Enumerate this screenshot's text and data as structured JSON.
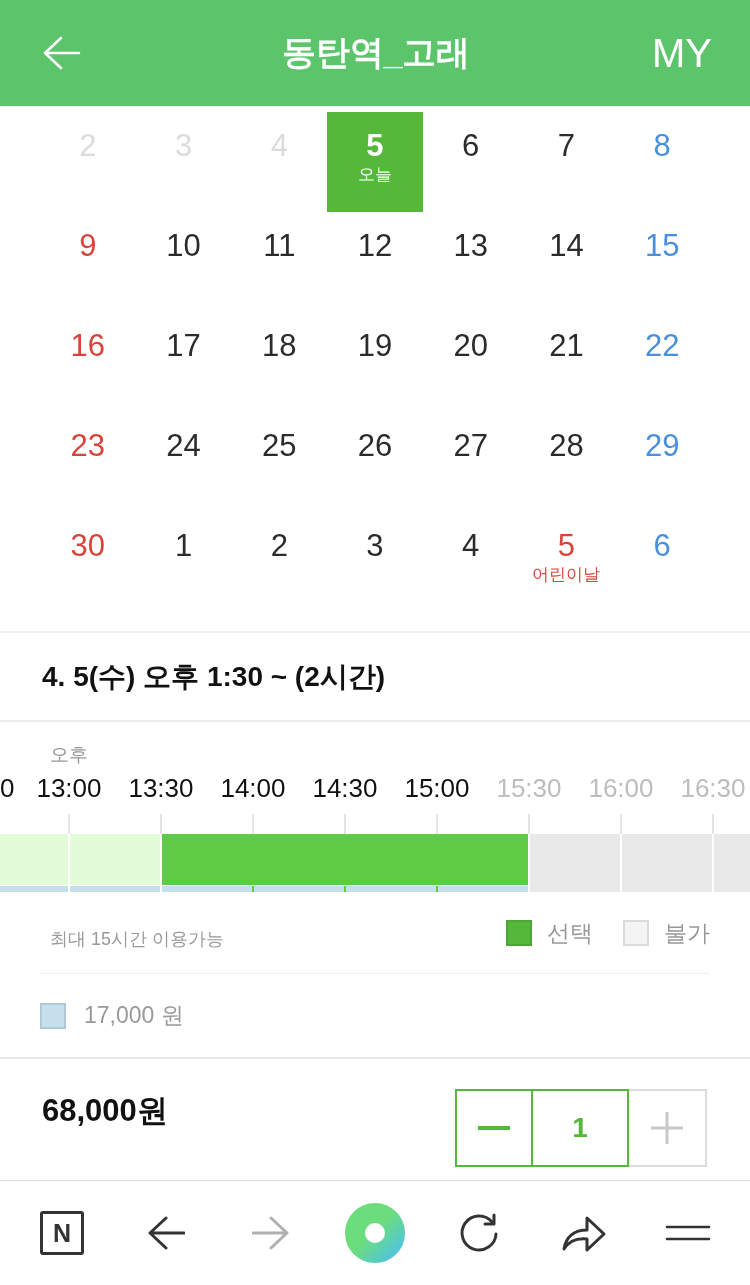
{
  "header": {
    "title": "동탄역_고래",
    "link": "MY"
  },
  "calendar": {
    "weeks": [
      [
        {
          "day": "2",
          "selected": false,
          "disabled": true,
          "holiday": false
        },
        {
          "day": "3",
          "selected": false,
          "disabled": true,
          "holiday": false
        },
        {
          "day": "4",
          "selected": false,
          "disabled": true,
          "holiday": false
        },
        {
          "day": "5",
          "note": "오늘",
          "selected": true,
          "disabled": false,
          "holiday": false
        },
        {
          "day": "6",
          "selected": false,
          "disabled": false,
          "holiday": false
        },
        {
          "day": "7",
          "selected": false,
          "disabled": false,
          "holiday": false
        },
        {
          "day": "8",
          "selected": false,
          "disabled": false,
          "holiday": false
        }
      ],
      [
        {
          "day": "9",
          "selected": false,
          "disabled": false,
          "holiday": true
        },
        {
          "day": "10",
          "selected": false,
          "disabled": false,
          "holiday": false
        },
        {
          "day": "11",
          "selected": false,
          "disabled": false,
          "holiday": false
        },
        {
          "day": "12",
          "selected": false,
          "disabled": false,
          "holiday": false
        },
        {
          "day": "13",
          "selected": false,
          "disabled": false,
          "holiday": false
        },
        {
          "day": "14",
          "selected": false,
          "disabled": false,
          "holiday": false
        },
        {
          "day": "15",
          "selected": false,
          "disabled": false,
          "holiday": false
        }
      ],
      [
        {
          "day": "16",
          "selected": false,
          "disabled": false,
          "holiday": true
        },
        {
          "day": "17",
          "selected": false,
          "disabled": false,
          "holiday": false
        },
        {
          "day": "18",
          "selected": false,
          "disabled": false,
          "holiday": false
        },
        {
          "day": "19",
          "selected": false,
          "disabled": false,
          "holiday": false
        },
        {
          "day": "20",
          "selected": false,
          "disabled": false,
          "holiday": false
        },
        {
          "day": "21",
          "selected": false,
          "disabled": false,
          "holiday": false
        },
        {
          "day": "22",
          "selected": false,
          "disabled": false,
          "holiday": false
        }
      ],
      [
        {
          "day": "23",
          "selected": false,
          "disabled": false,
          "holiday": true
        },
        {
          "day": "24",
          "selected": false,
          "disabled": false,
          "holiday": false
        },
        {
          "day": "25",
          "selected": false,
          "disabled": false,
          "holiday": false
        },
        {
          "day": "26",
          "selected": false,
          "disabled": false,
          "holiday": false
        },
        {
          "day": "27",
          "selected": false,
          "disabled": false,
          "holiday": false
        },
        {
          "day": "28",
          "selected": false,
          "disabled": false,
          "holiday": false
        },
        {
          "day": "29",
          "selected": false,
          "disabled": false,
          "holiday": false
        }
      ],
      [
        {
          "day": "30",
          "selected": false,
          "disabled": false,
          "holiday": true
        },
        {
          "day": "1",
          "selected": false,
          "disabled": false,
          "holiday": false
        },
        {
          "day": "2",
          "selected": false,
          "disabled": false,
          "holiday": false
        },
        {
          "day": "3",
          "selected": false,
          "disabled": false,
          "holiday": false
        },
        {
          "day": "4",
          "selected": false,
          "disabled": false,
          "holiday": false
        },
        {
          "day": "5",
          "note": "어린이날",
          "selected": false,
          "disabled": false,
          "holiday": true
        },
        {
          "day": "6",
          "selected": false,
          "disabled": false,
          "holiday": false
        }
      ]
    ]
  },
  "summary": "4. 5(수) 오후 1:30 ~ (2시간)",
  "timeline": {
    "slots": [
      {
        "label": "0",
        "selected": false,
        "available": true
      },
      {
        "label": "13:00",
        "period": "오후",
        "selected": false,
        "available": true
      },
      {
        "label": "13:30",
        "selected": true,
        "available": true
      },
      {
        "label": "14:00",
        "selected": true,
        "available": true
      },
      {
        "label": "14:30",
        "selected": true,
        "available": true
      },
      {
        "label": "15:00",
        "selected": true,
        "available": true
      },
      {
        "label": "15:30",
        "selected": false,
        "available": false
      },
      {
        "label": "16:00",
        "selected": false,
        "available": false
      },
      {
        "label": "16:30",
        "selected": false,
        "available": false
      }
    ]
  },
  "notice": "최대 15시간 이용가능",
  "legend": [
    {
      "label": "선택",
      "color": "#56b83b"
    },
    {
      "label": "불가",
      "color": "#f4f4f4"
    }
  ],
  "prices": [
    {
      "label": "17,000 원",
      "color": "#c5e0ea"
    }
  ],
  "total": "68,000원",
  "quantity": {
    "value": "1",
    "minus_disabled": false,
    "plus_disabled": true
  },
  "toolbar": [
    {
      "kind": "logo",
      "text": "N",
      "disabled": false
    },
    {
      "kind": "back",
      "disabled": false
    },
    {
      "kind": "forward",
      "disabled": true
    },
    {
      "kind": "home",
      "disabled": false
    },
    {
      "kind": "reload",
      "disabled": false
    },
    {
      "kind": "share",
      "disabled": false
    },
    {
      "kind": "menu",
      "disabled": false
    }
  ]
}
